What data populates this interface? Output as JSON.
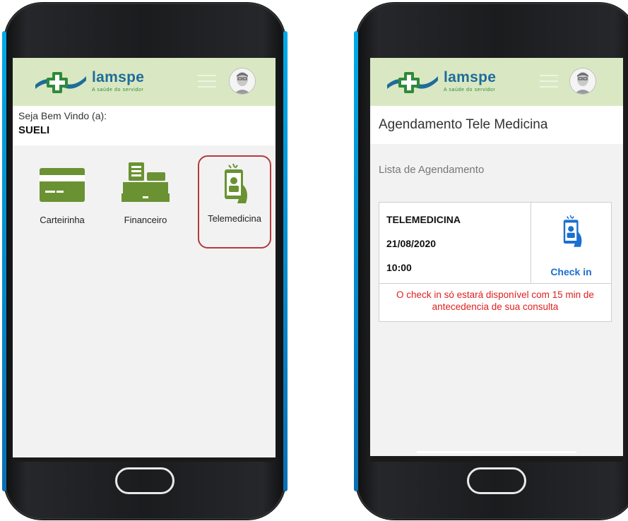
{
  "brand": {
    "name": "lamspe",
    "tagline": "A saúde do servidor",
    "colors": {
      "header_bg": "#d9e8c2",
      "logo_blue": "#1f6c9a",
      "logo_green": "#2f8a3a",
      "icon_green": "#6a9233",
      "accent_blue": "#1b6fd1",
      "alert_red": "#e01f1f",
      "selected_border": "#b73a3a"
    }
  },
  "home_screen": {
    "welcome_label": "Seja Bem Vindo (a):",
    "user_name": "SUELI",
    "tiles": [
      {
        "label": "Carteirinha",
        "icon": "id-card-icon",
        "selected": false
      },
      {
        "label": "Financeiro",
        "icon": "cash-register-icon",
        "selected": false
      },
      {
        "label": "Telemedicina",
        "icon": "phone-doctor-icon",
        "selected": true
      }
    ]
  },
  "schedule_screen": {
    "title": "Agendamento Tele Medicina",
    "subtitle": "Lista de Agendamento",
    "appointment": {
      "type": "TELEMEDICINA",
      "date": "21/08/2020",
      "time": "10:00",
      "checkin_label": "Check in",
      "notice": "O check in só estará disponível com 15 min de antecedencia de sua consulta"
    }
  },
  "icons": [
    "menu-icon",
    "avatar-icon",
    "id-card-icon",
    "cash-register-icon",
    "phone-doctor-icon"
  ]
}
